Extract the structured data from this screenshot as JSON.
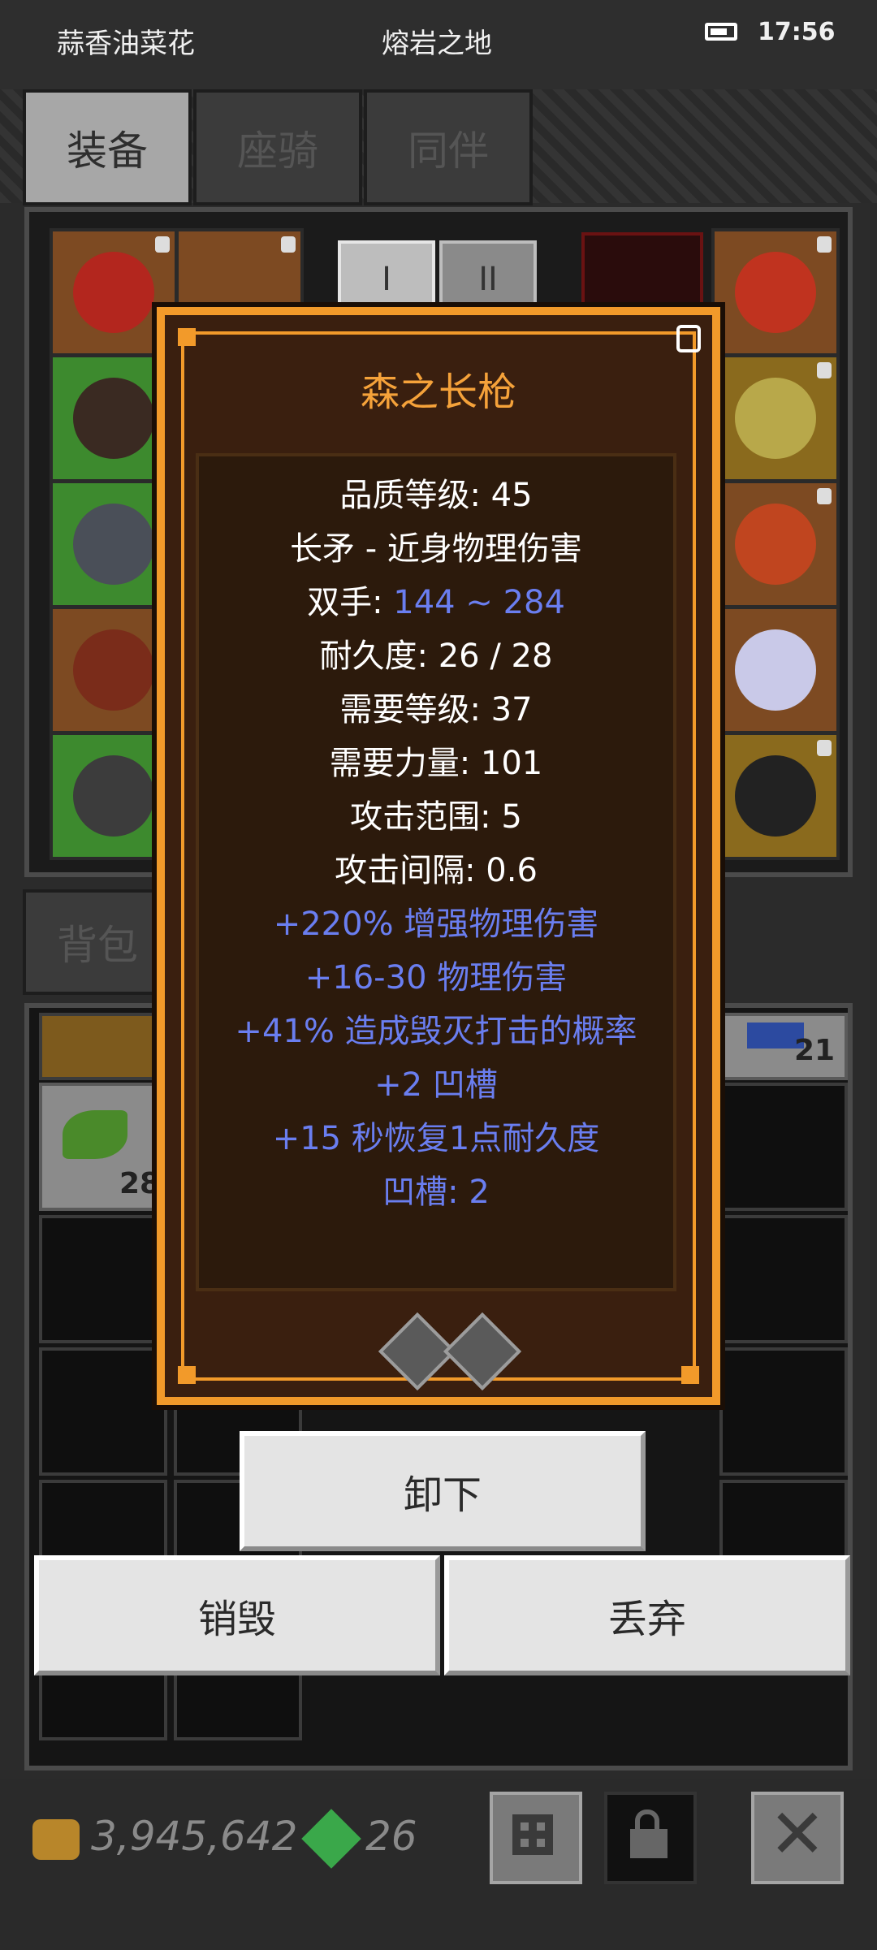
{
  "status_bar": {
    "left_text": "蒜香油菜花",
    "center_text": "熔岩之地",
    "time": "17:56"
  },
  "tabs": [
    {
      "label": "装备",
      "active": true
    },
    {
      "label": "座骑",
      "active": false
    },
    {
      "label": "同伴",
      "active": false
    }
  ],
  "equip_panel": {
    "page_buttons": [
      "I",
      "II"
    ]
  },
  "bag_tab": {
    "label": "背包 ("
  },
  "bag": {
    "visible_counts": [
      "21",
      "28"
    ]
  },
  "item": {
    "name": "森之长枪",
    "stats": [
      {
        "text": "品质等级: 45"
      },
      {
        "text": "长矛 - 近身物理伤害"
      },
      {
        "label": "双手: ",
        "value": "144 ~ 284"
      },
      {
        "text": "耐久度: 26 / 28"
      },
      {
        "text": "需要等级: 37"
      },
      {
        "text": "需要力量: 101"
      },
      {
        "text": "攻击范围: 5"
      },
      {
        "text": "攻击间隔: 0.6"
      }
    ],
    "affixes": [
      "+220% 增强物理伤害",
      "+16-30 物理伤害",
      "+41% 造成毁灭打击的概率",
      "+2 凹槽",
      "+15 秒恢复1点耐久度",
      "凹槽: 2"
    ],
    "socket_count": 2
  },
  "actions": {
    "unequip": "卸下",
    "destroy": "销毁",
    "discard": "丢弃"
  },
  "currency": {
    "gold": "3,945,642",
    "gems": "26"
  },
  "colors": {
    "accent_orange": "#f29a2a",
    "title_orange": "#f5a23a",
    "affix_blue": "#6a7ef0"
  },
  "toolbar_icons": [
    "grid-icon",
    "lock-icon",
    "close-icon"
  ]
}
